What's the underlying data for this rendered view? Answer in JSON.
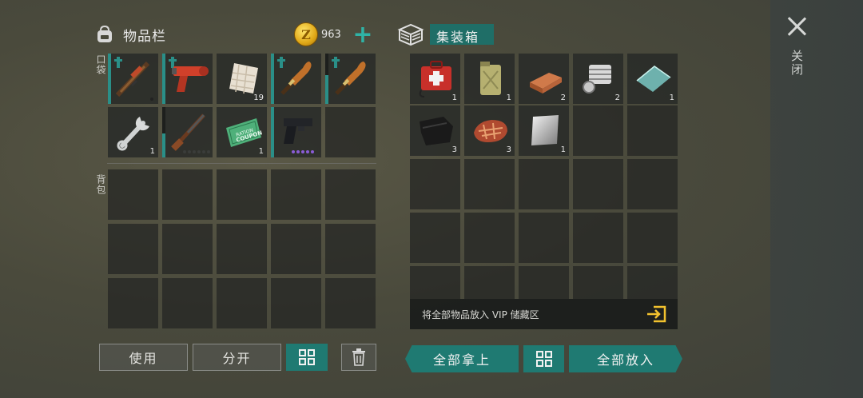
{
  "inventory": {
    "title": "物品栏",
    "coins": "963",
    "pocket_label": "口袋",
    "backpack_label": "背包",
    "pocket_items": [
      {
        "name": "sniper-rifle-icon",
        "qty": ""
      },
      {
        "name": "flare-gun-icon",
        "qty": ""
      },
      {
        "name": "cloth-icon",
        "qty": "19"
      },
      {
        "name": "machete-icon",
        "qty": ""
      },
      {
        "name": "machete-icon",
        "qty": ""
      },
      {
        "name": "wrench-icon",
        "qty": "1"
      },
      {
        "name": "shotgun-icon",
        "qty": ""
      },
      {
        "name": "ration-coupon-icon",
        "qty": "1"
      },
      {
        "name": "pistol-icon",
        "qty": ""
      },
      {
        "name": "",
        "qty": ""
      }
    ]
  },
  "container": {
    "title": "集装箱",
    "items": [
      {
        "name": "first-aid-kit-icon",
        "qty": "1"
      },
      {
        "name": "jerrycan-icon",
        "qty": "1"
      },
      {
        "name": "copper-ingot-icon",
        "qty": "2"
      },
      {
        "name": "engine-part-icon",
        "qty": "2"
      },
      {
        "name": "glass-sheet-icon",
        "qty": "1"
      },
      {
        "name": "leather-icon",
        "qty": "3"
      },
      {
        "name": "steak-icon",
        "qty": "3"
      },
      {
        "name": "steel-plate-icon",
        "qty": "1"
      }
    ],
    "vip_text": "将全部物品放入 VIP 储藏区"
  },
  "buttons": {
    "use": "使用",
    "split": "分开",
    "take_all": "全部拿上",
    "put_all": "全部放入",
    "close": "关闭"
  },
  "colors": {
    "accent": "#1f7a72",
    "plus": "#2fb3a6",
    "durability": "#2a8f88"
  }
}
